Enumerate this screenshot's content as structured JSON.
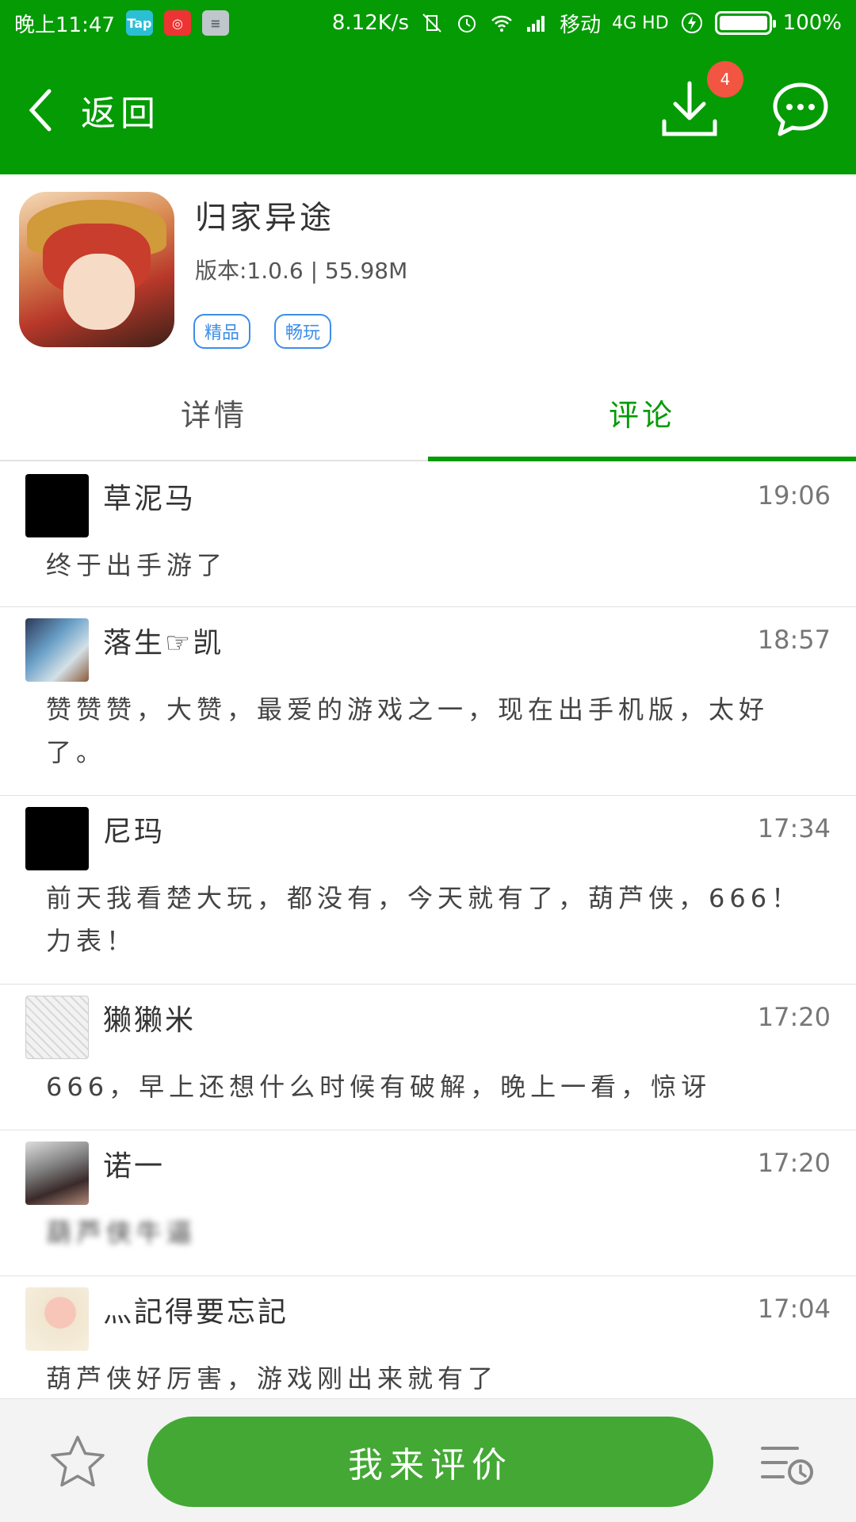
{
  "status_bar": {
    "time": "晚上11:47",
    "tap_label": "Tap",
    "speed": "8.12K/s",
    "carrier": "移动",
    "network": "4G HD",
    "battery": "100%"
  },
  "nav": {
    "back_label": "返回",
    "download_count": "4"
  },
  "app": {
    "title": "归家异途",
    "meta": "版本:1.0.6 | 55.98M",
    "tags": [
      "精品",
      "畅玩"
    ]
  },
  "tabs": [
    {
      "label": "详情",
      "active": false
    },
    {
      "label": "评论",
      "active": true
    }
  ],
  "comments": [
    {
      "name": "草泥马",
      "time": "19:06",
      "text": "终于出手游了"
    },
    {
      "name": "落生☞凯",
      "time": "18:57",
      "text": "赞赞赞，大赞，最爱的游戏之一，现在出手机版，太好了。"
    },
    {
      "name": "尼玛",
      "time": "17:34",
      "text": "前天我看楚大玩，都没有，今天就有了，葫芦侠，666！力表！"
    },
    {
      "name": "獭獭米",
      "time": "17:20",
      "text": "666，早上还想什么时候有破解，晚上一看，惊讶"
    },
    {
      "name": "诺一",
      "time": "17:20",
      "text": "葫芦侠牛逼"
    },
    {
      "name": "灬記得要忘記",
      "time": "17:04",
      "text": "葫芦侠好厉害，游戏刚出来就有了"
    }
  ],
  "bottom": {
    "rate_label": "我来评价"
  },
  "colors": {
    "brand_green": "#049b04",
    "button_green": "#43a834",
    "badge_red": "#f25542",
    "tag_blue": "#3d8ee8"
  }
}
